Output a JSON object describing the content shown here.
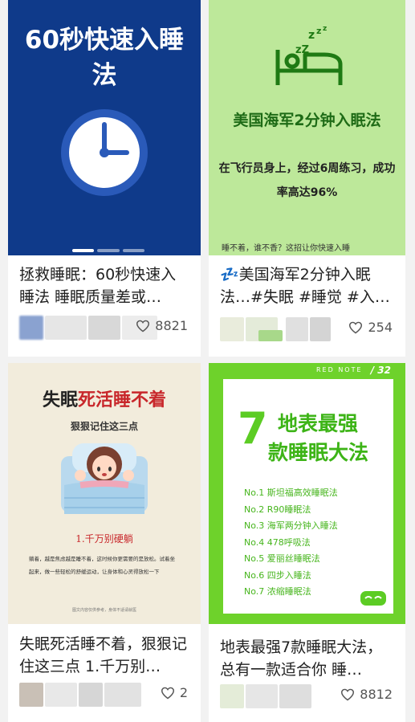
{
  "cards": [
    {
      "cover": {
        "title": "60秒快速入睡法"
      },
      "caption": "拯救睡眠：60秒快速入睡法 睡眠质量差或…",
      "likes": "8821"
    },
    {
      "cover": {
        "title": "美国海军2分钟入眠法",
        "subtitle": "在飞行员身上，经过6周练习，成功率高达96%",
        "footer": "睡不着，谁不香？这招让你快速入睡"
      },
      "caption": "💤美国海军2分钟入眠法…#失眠 #睡觉 #入…",
      "likes": "254"
    },
    {
      "cover": {
        "title_black": "失眠",
        "title_red": "死活睡不着",
        "subtitle": "狠狠记住这三点",
        "point": "1.千万别硬躺",
        "body": "躺着，越是焦虑越是睡不着，这时候你更需要的是放松。试着坐起来，做一些轻松的舒缓运动，让身体和心灵得放松一下",
        "footer": "图文内容仅供参考，身体不适请就医"
      },
      "caption": "失眠死活睡不着，狠狠记住这三点 1.千万别…",
      "likes": "2"
    },
    {
      "cover": {
        "tag": "RED NOTE",
        "page": "32",
        "number": "7",
        "title_line1": "地表最强",
        "title_line2": "款睡眠大法",
        "items": [
          "No.1  斯坦福高效睡眠法",
          "No.2  R90睡眠法",
          "No.3  海军两分钟入睡法",
          "No.4  478呼吸法",
          "No.5  爱丽丝睡眠法",
          "No.6  四步入睡法",
          "No.7  浓缩睡眠法"
        ]
      },
      "caption": "地表最强7款睡眠大法，总有一款适合你 睡…",
      "likes": "8812"
    }
  ],
  "colors": {
    "card1_bg": "#0f3a8a",
    "card2_bg": "#bde89a",
    "card3_bg": "#f2ecdc",
    "card4_bg": "#6ed22b",
    "accent_red": "#c8272b"
  }
}
